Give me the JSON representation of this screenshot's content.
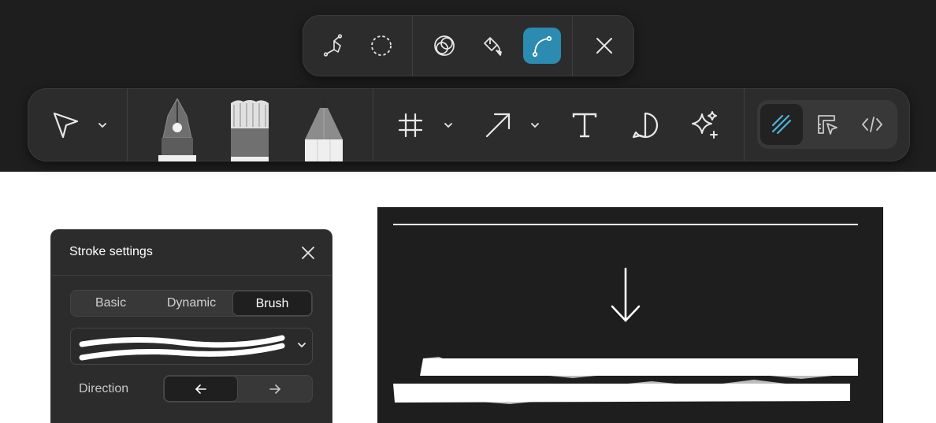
{
  "colors": {
    "background_dark": "#1e1e1e",
    "toolbar": "#2c2c2c",
    "accent": "#2b8bb0",
    "draw_mode_icon": "#4fb3d6"
  },
  "sub_toolbar": {
    "tools": [
      {
        "icon": "vector-pen-icon"
      },
      {
        "icon": "lasso-icon"
      },
      {
        "icon": "boolean-icon"
      },
      {
        "icon": "paint-bucket-icon"
      },
      {
        "icon": "bend-curve-icon",
        "active": true
      },
      {
        "icon": "close-icon"
      }
    ]
  },
  "main_toolbar": {
    "tools": [
      {
        "icon": "move-cursor-icon",
        "has_dropdown": true
      },
      {
        "icon": "pen-nib-tool-icon"
      },
      {
        "icon": "paintbrush-tool-icon"
      },
      {
        "icon": "pencil-tool-icon"
      },
      {
        "icon": "frame-icon",
        "has_dropdown": true
      },
      {
        "icon": "arrow-icon",
        "has_dropdown": true
      },
      {
        "icon": "text-icon"
      },
      {
        "icon": "comment-icon"
      },
      {
        "icon": "ai-sparkle-icon"
      }
    ],
    "modes": [
      {
        "icon": "draw-mode-icon",
        "active": true
      },
      {
        "icon": "design-mode-icon"
      },
      {
        "icon": "dev-mode-icon"
      }
    ]
  },
  "stroke_panel": {
    "title": "Stroke settings",
    "tabs": [
      "Basic",
      "Dynamic",
      "Brush"
    ],
    "active_tab": "Brush",
    "direction_label": "Direction",
    "direction_selected": "left"
  }
}
